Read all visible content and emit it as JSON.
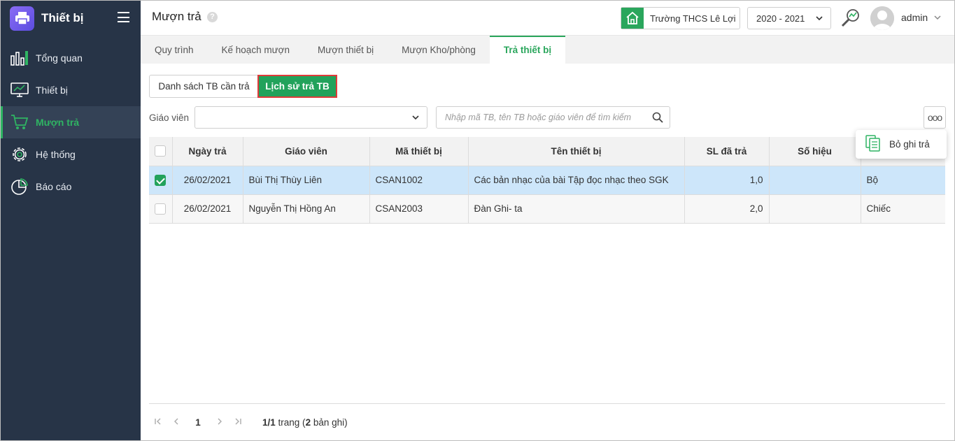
{
  "app": {
    "title": "Thiết bị"
  },
  "sidebar": {
    "items": [
      {
        "label": "Tổng quan",
        "icon": "chart-bars-icon"
      },
      {
        "label": "Thiết bị",
        "icon": "monitor-icon"
      },
      {
        "label": "Mượn trả",
        "icon": "cart-icon",
        "active": true
      },
      {
        "label": "Hệ thống",
        "icon": "gear-icon"
      },
      {
        "label": "Báo cáo",
        "icon": "pie-chart-icon"
      }
    ]
  },
  "header": {
    "page_title": "Mượn trả",
    "help": "?",
    "school": "Trường THCS Lê Lợi",
    "year": "2020 - 2021",
    "user": "admin"
  },
  "tabs": [
    {
      "label": "Quy trình"
    },
    {
      "label": "Kế hoạch mượn"
    },
    {
      "label": "Mượn thiết bị"
    },
    {
      "label": "Mượn Kho/phòng"
    },
    {
      "label": "Trả thiết bị",
      "active": true
    }
  ],
  "subtabs": {
    "list_label": "Danh sách TB cần trả",
    "history_label": "Lịch sử trả TB"
  },
  "filters": {
    "teacher_label": "Giáo viên",
    "teacher_value": "",
    "search_placeholder": "Nhập mã TB, tên TB hoặc giáo viên để tìm kiếm",
    "more": "ooo"
  },
  "table": {
    "columns": [
      "Ngày trả",
      "Giáo viên",
      "Mã thiết bị",
      "Tên thiết bị",
      "SL đã trả",
      "Số hiệu",
      ""
    ],
    "rows": [
      {
        "checked": true,
        "date": "26/02/2021",
        "teacher": "Bùi Thị Thùy Liên",
        "code": "CSAN1002",
        "name": "Các bản nhạc của bài Tập đọc nhạc theo SGK",
        "qty": "1,0",
        "serial": "",
        "unit": "Bộ"
      },
      {
        "checked": false,
        "date": "26/02/2021",
        "teacher": "Nguyễn Thị Hồng An",
        "code": "CSAN2003",
        "name": "Đàn Ghi- ta",
        "qty": "2,0",
        "serial": "",
        "unit": "Chiếc"
      }
    ]
  },
  "popup": {
    "label": "Bỏ ghi trả"
  },
  "pager": {
    "page": "1",
    "info_pages": "1/1",
    "info_text1": " trang (",
    "info_count": "2",
    "info_text2": " bản ghi)"
  },
  "colors": {
    "sidebar_bg": "#273447",
    "accent": "#22a25b",
    "selected_row": "#cde6fa",
    "highlight_border": "#e03a3a"
  }
}
